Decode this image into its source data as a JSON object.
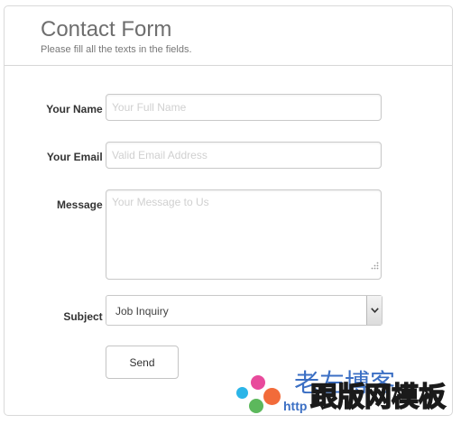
{
  "form": {
    "title": "Contact Form",
    "subtitle": "Please fill all the texts in the fields.",
    "name_label": "Your Name :",
    "name_placeholder": "Your Full Name",
    "email_label": "Your Email :",
    "email_placeholder": "Valid Email Address",
    "message_label": "Message :",
    "message_placeholder": "Your Message to Us",
    "subject_label": "Subject :",
    "subject_value": "Job Inquiry",
    "send_label": "Send"
  },
  "watermark": {
    "top_text": "老左博客",
    "url_text": "http",
    "bottom_text": "跟版网模板",
    "colors": [
      "#2bb5e8",
      "#e84a9c",
      "#5cb85c",
      "#f26b3a"
    ]
  },
  "icons": {
    "select_arrow": "chevron-down-icon",
    "resize": "resize-grip-icon"
  }
}
